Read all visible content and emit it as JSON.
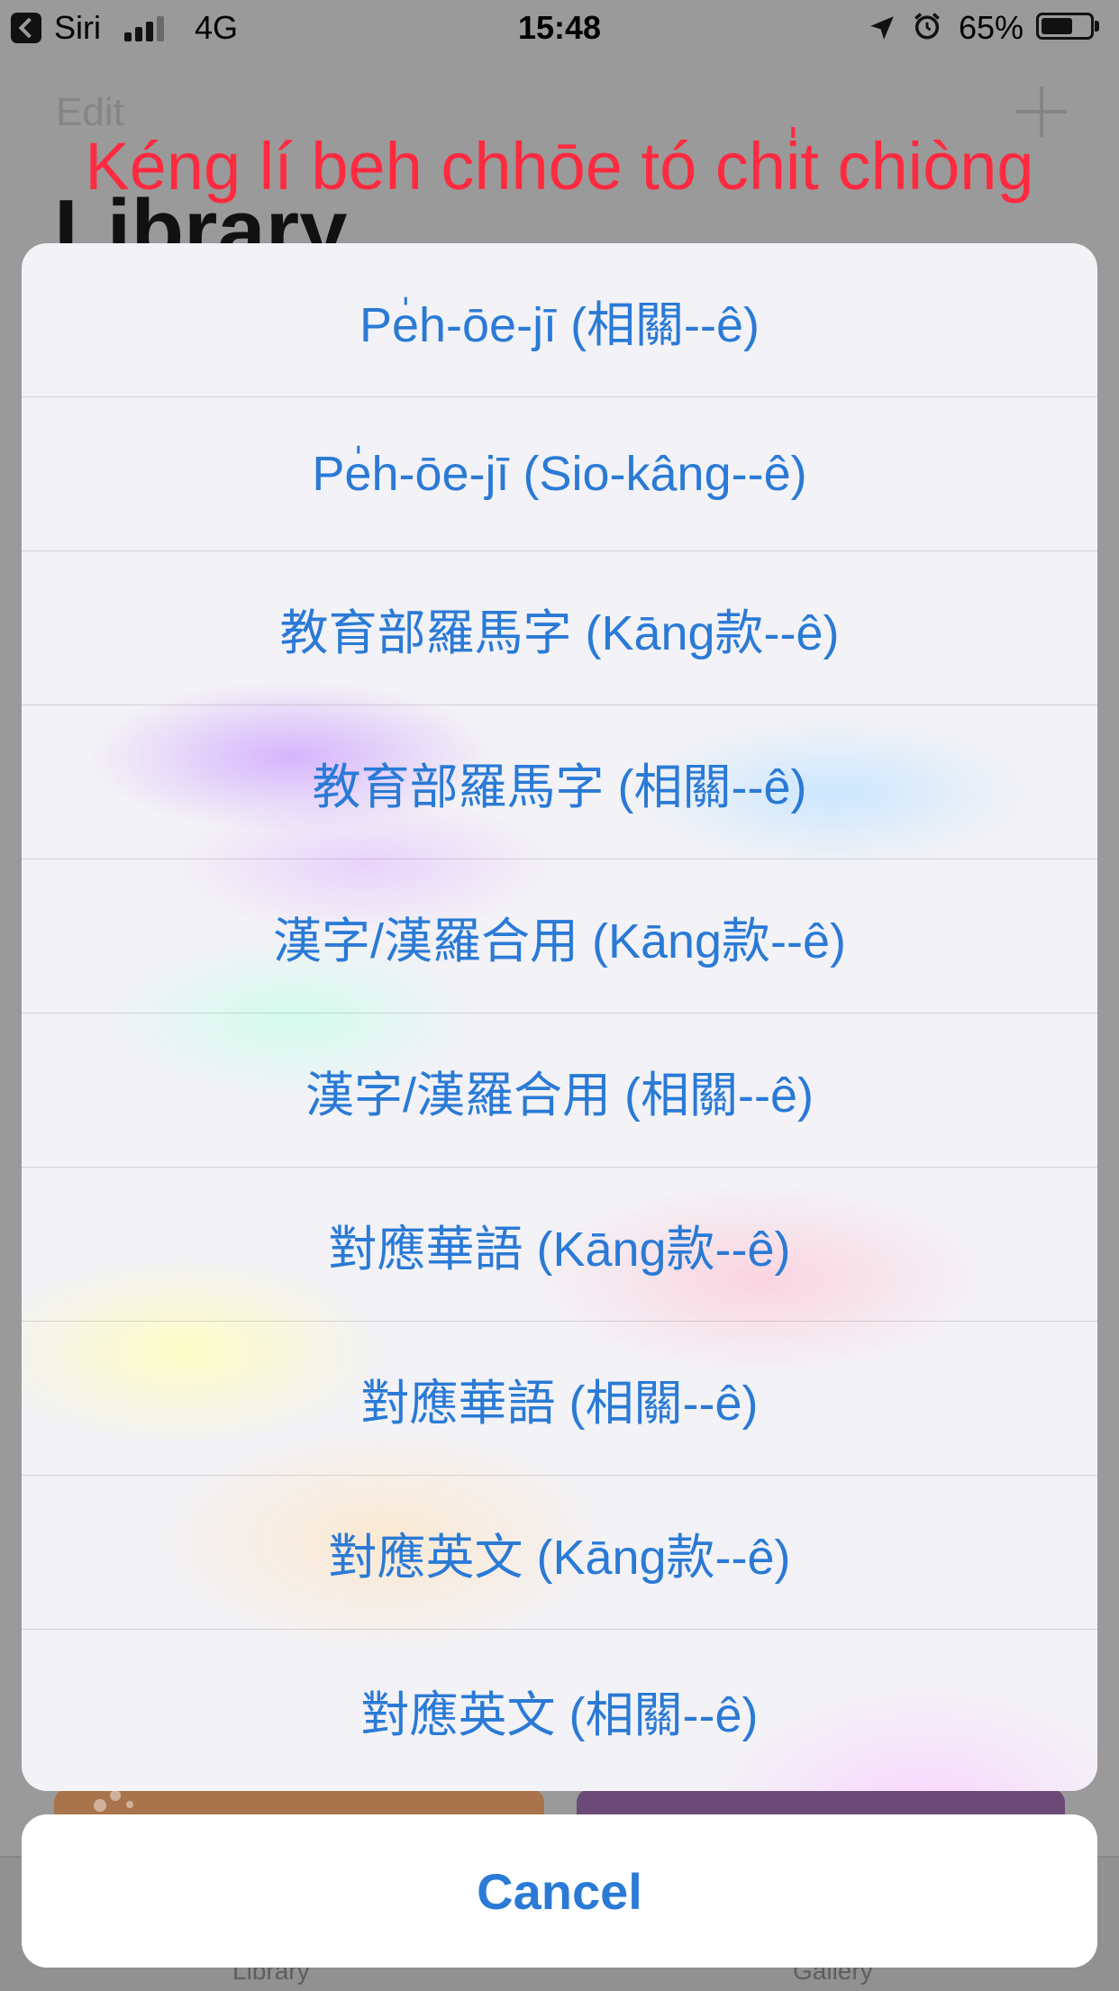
{
  "status_bar": {
    "carrier": "Siri",
    "network": "4G",
    "time": "15:48",
    "battery": "65%",
    "battery_level": 0.65
  },
  "nav": {
    "edit_label": "Edit",
    "page_title": "Library"
  },
  "overlay_caption": "Kéng lí beh chhōe tó chi̍t chiòng",
  "action_sheet": {
    "items": [
      "Pe̍h-ōe-jī (相關--ê)",
      "Pe̍h-ōe-jī (Sio-kâng--ê)",
      "教育部羅馬字 (Kāng款--ê)",
      "教育部羅馬字 (相關--ê)",
      "漢字/漢羅合用 (Kāng款--ê)",
      "漢字/漢羅合用 (相關--ê)",
      "對應華語 (Kāng款--ê)",
      "對應華語 (相關--ê)",
      "對應英文 (Kāng款--ê)",
      "對應英文 (相關--ê)"
    ],
    "cancel_label": "Cancel"
  },
  "tab_bar": {
    "library_label": "Library",
    "gallery_label": "Gallery"
  },
  "colors": {
    "accent": "#2a7ad6",
    "caption": "#ff2a3f"
  }
}
